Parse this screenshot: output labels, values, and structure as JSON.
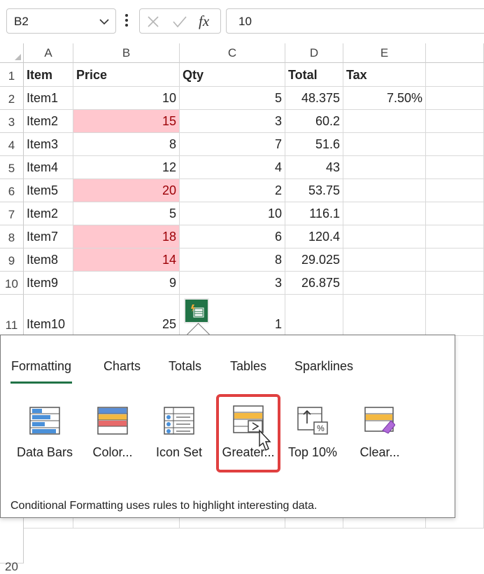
{
  "formula_bar": {
    "name_box": "B2",
    "formula_value": "10",
    "fx_label": "fx"
  },
  "columns": [
    "A",
    "B",
    "C",
    "D",
    "E"
  ],
  "rows": [
    {
      "num": "1",
      "cells": [
        "Item",
        "Price",
        "Qty",
        "Total",
        "Tax"
      ]
    },
    {
      "num": "2",
      "cells": [
        "Item1",
        "10",
        "5",
        "48.375",
        "7.50%"
      ]
    },
    {
      "num": "3",
      "cells": [
        "Item2",
        "15",
        "3",
        "60.2",
        ""
      ]
    },
    {
      "num": "4",
      "cells": [
        "Item3",
        "8",
        "7",
        "51.6",
        ""
      ]
    },
    {
      "num": "5",
      "cells": [
        "Item4",
        "12",
        "4",
        "43",
        ""
      ]
    },
    {
      "num": "6",
      "cells": [
        "Item5",
        "20",
        "2",
        "53.75",
        ""
      ]
    },
    {
      "num": "7",
      "cells": [
        "Item2",
        "5",
        "10",
        "116.1",
        ""
      ]
    },
    {
      "num": "8",
      "cells": [
        "Item7",
        "18",
        "6",
        "120.4",
        ""
      ]
    },
    {
      "num": "9",
      "cells": [
        "Item8",
        "14",
        "8",
        "29.025",
        ""
      ]
    },
    {
      "num": "10",
      "cells": [
        "Item9",
        "9",
        "3",
        "26.875",
        ""
      ]
    },
    {
      "num": "11",
      "cells": [
        "Item10",
        "25",
        "1",
        "",
        ""
      ]
    },
    {
      "num": "20",
      "cells": [
        "",
        "",
        "",
        "",
        ""
      ]
    }
  ],
  "highlight_color": "#ffc7ce",
  "quick_analysis": {
    "tabs": [
      "Formatting",
      "Charts",
      "Totals",
      "Tables",
      "Sparklines"
    ],
    "active_tab": "Formatting",
    "options": [
      "Data Bars",
      "Color...",
      "Icon Set",
      "Greater...",
      "Top 10%",
      "Clear..."
    ],
    "selected_option": "Greater...",
    "description": "Conditional Formatting uses rules to highlight interesting data."
  },
  "accent_color": "#217346"
}
